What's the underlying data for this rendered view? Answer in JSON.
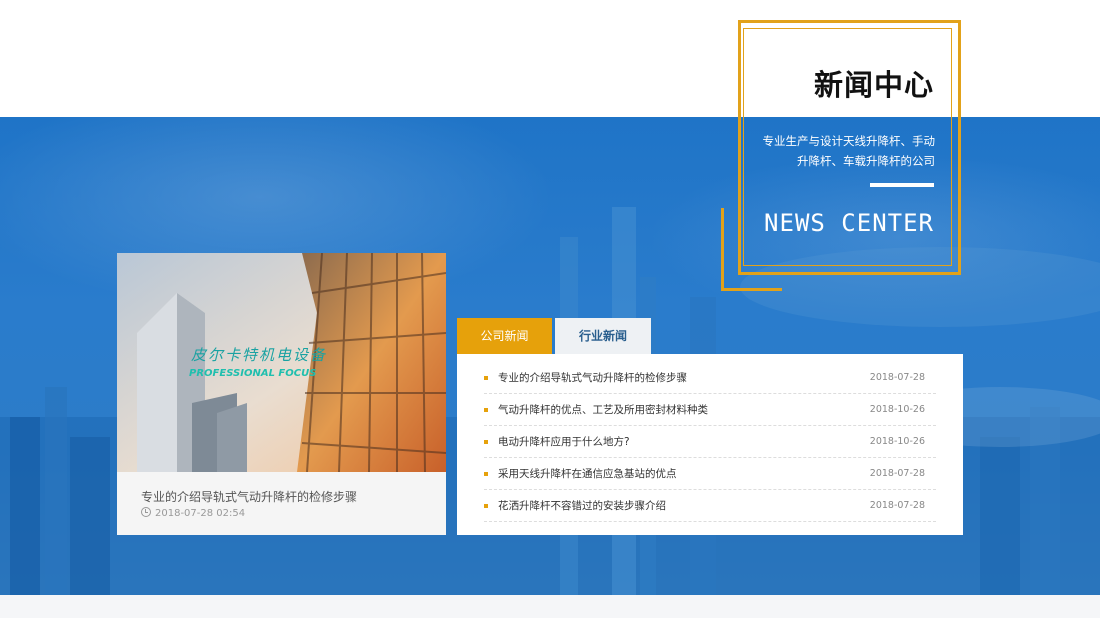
{
  "news_center": {
    "title_cn": "新闻中心",
    "description": "专业生产与设计天线升降杆、手动升降杆、车载升降杆的公司",
    "title_en": "NEWS CENTER"
  },
  "featured": {
    "brand_cn": "皮尔卡特机电设备",
    "brand_en": "PROFESSIONAL FOCUS",
    "title": "专业的介绍导轨式气动升降杆的检修步骤",
    "datetime": "2018-07-28 02:54"
  },
  "tabs": [
    {
      "label": "公司新闻",
      "active": true
    },
    {
      "label": "行业新闻",
      "active": false
    }
  ],
  "news_list": [
    {
      "title": "专业的介绍导轨式气动升降杆的检修步骤",
      "date": "2018-07-28"
    },
    {
      "title": "气动升降杆的优点、工艺及所用密封材料种类",
      "date": "2018-10-26"
    },
    {
      "title": "电动升降杆应用于什么地方?",
      "date": "2018-10-26"
    },
    {
      "title": "采用天线升降杆在通信应急基站的优点",
      "date": "2018-07-28"
    },
    {
      "title": "花洒升降杆不容错过的安装步骤介绍",
      "date": "2018-07-28"
    }
  ],
  "colors": {
    "accent": "#e6a10b",
    "banner": "#1f74c7"
  }
}
